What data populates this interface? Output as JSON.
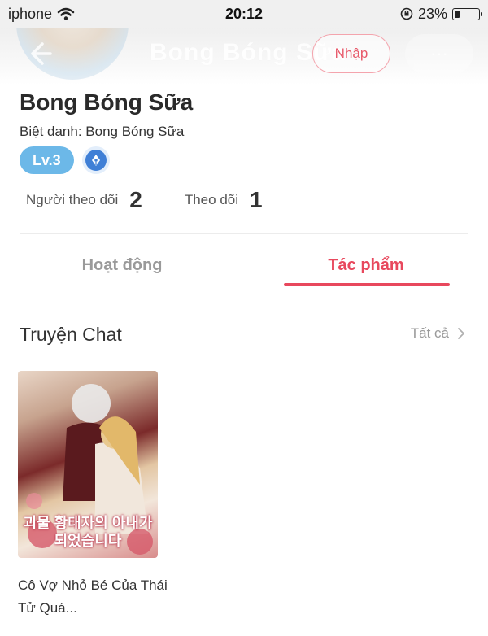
{
  "status_bar": {
    "carrier": "iphone",
    "time": "20:12",
    "battery_percent": "23%",
    "battery_level": 0.23
  },
  "header": {
    "title": "Bong Bóng Sữa",
    "join_label": "Nhập",
    "more_label": "···"
  },
  "profile": {
    "name": "Bong Bóng Sữa",
    "nickname_prefix": "Biệt danh: ",
    "nickname": "Bong Bóng Sữa",
    "level": "Lv.3",
    "stats": [
      {
        "label": "Người theo dõi",
        "value": "2"
      },
      {
        "label": "Theo dõi",
        "value": "1"
      }
    ]
  },
  "tabs": [
    {
      "label": "Hoạt động",
      "active": false
    },
    {
      "label": "Tác phẩm",
      "active": true
    }
  ],
  "section": {
    "title": "Truyện Chat",
    "see_all": "Tất cả"
  },
  "works": [
    {
      "title": "Cô Vợ Nhỏ Bé Của Thái Tử Quá...",
      "cover_text": "괴물 황태자의 아내가 되었습니다"
    }
  ],
  "colors": {
    "accent": "#e8485d",
    "level_badge": "#6cb8e8",
    "pen_badge": "#3f7fd6"
  }
}
